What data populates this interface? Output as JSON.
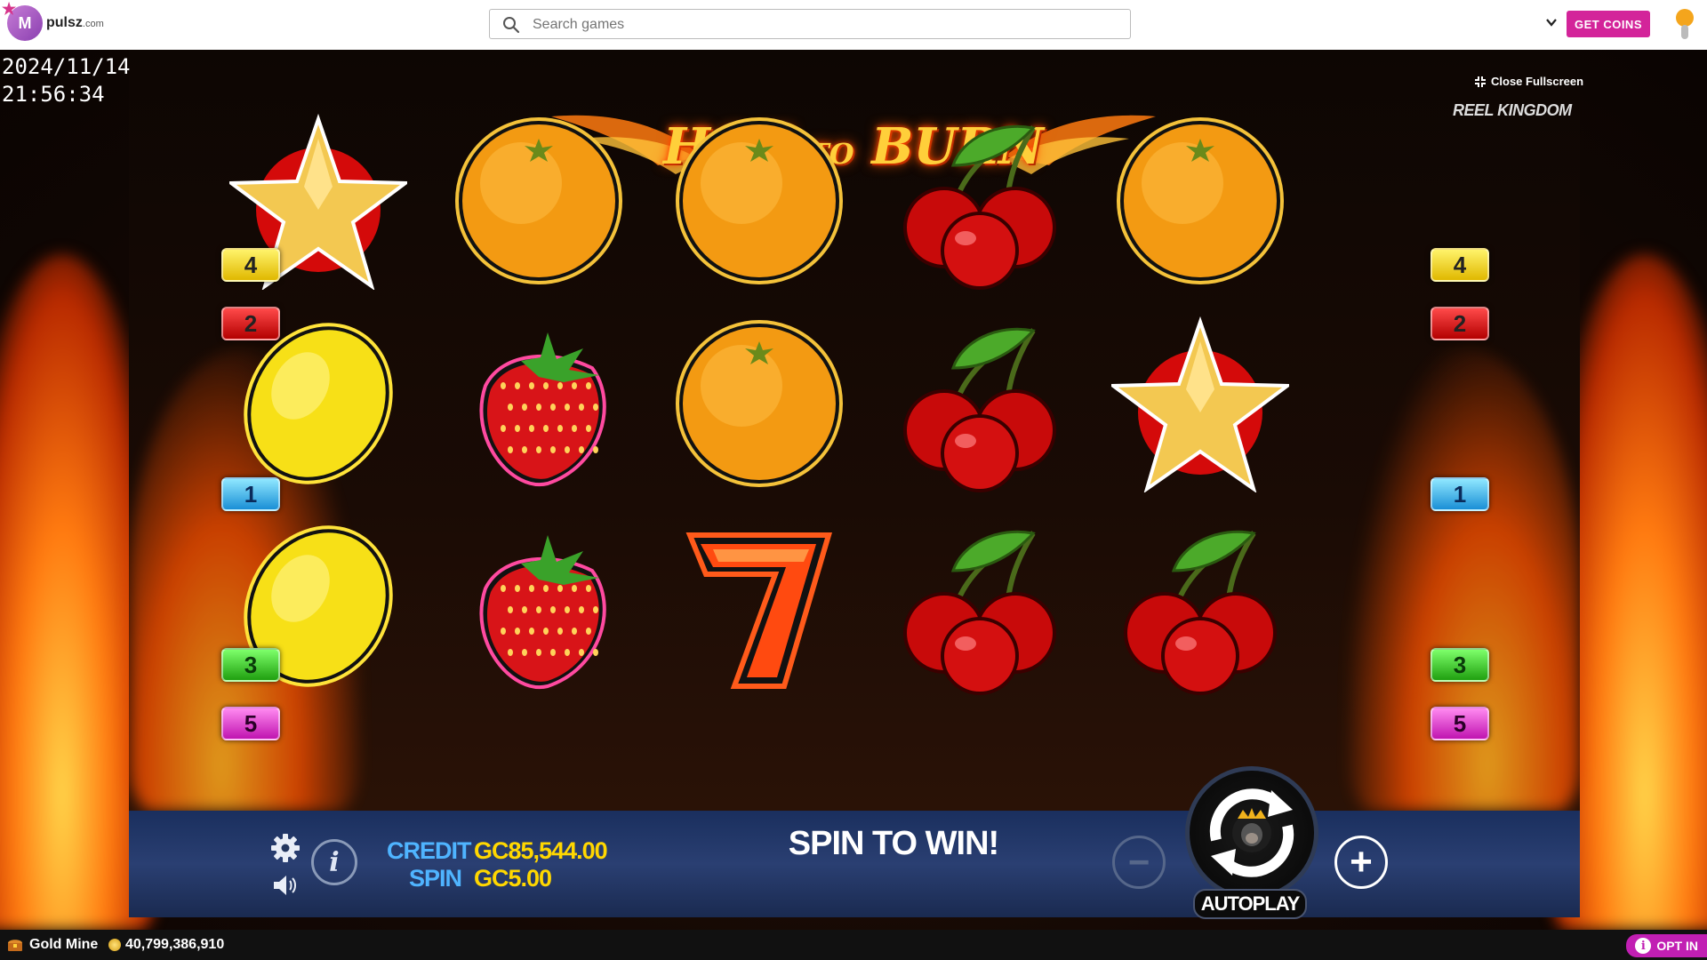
{
  "header": {
    "logo_letter": "M",
    "logo_name": "pulsz",
    "logo_suffix": ".com",
    "search_placeholder": "Search games",
    "get_coins_label": "GET COINS"
  },
  "game": {
    "date": "2024/11/14",
    "time": "21:56:34",
    "close_fullscreen_label": "Close Fullscreen",
    "provider": "REEL KINGDOM",
    "title_part1": "HOT",
    "title_part2": "TO",
    "title_part3": "BURN",
    "reels": [
      [
        "star",
        "lemon",
        "lemon"
      ],
      [
        "orange",
        "strawberry",
        "strawberry"
      ],
      [
        "orange",
        "orange",
        "seven"
      ],
      [
        "cherry",
        "cherry",
        "cherry"
      ],
      [
        "orange",
        "star",
        "cherry"
      ]
    ],
    "paylines_left": [
      {
        "num": "4",
        "color": "yellow"
      },
      {
        "num": "2",
        "color": "red"
      },
      {
        "num": "1",
        "color": "blue"
      },
      {
        "num": "3",
        "color": "green"
      },
      {
        "num": "5",
        "color": "magenta"
      }
    ],
    "paylines_right": [
      {
        "num": "4",
        "color": "yellow"
      },
      {
        "num": "2",
        "color": "red"
      },
      {
        "num": "1",
        "color": "blue"
      },
      {
        "num": "3",
        "color": "green"
      },
      {
        "num": "5",
        "color": "magenta"
      }
    ],
    "panel": {
      "credit_label": "CREDIT",
      "credit_value": "GC85,544.00",
      "spin_label": "SPIN",
      "spin_value": "GC5.00",
      "message": "SPIN TO WIN!",
      "minus_symbol": "−",
      "plus_symbol": "+",
      "autoplay_label": "AUTOPLAY",
      "info_symbol": "i"
    }
  },
  "footer": {
    "currency_name": "Gold Mine",
    "balance": "40,799,386,910",
    "opt_in_label": "OPT IN",
    "opt_in_icon": "i"
  },
  "colors": {
    "brand_pink": "#d3249a",
    "credit_label": "#4fb4ff",
    "credit_value": "#ffd700"
  }
}
